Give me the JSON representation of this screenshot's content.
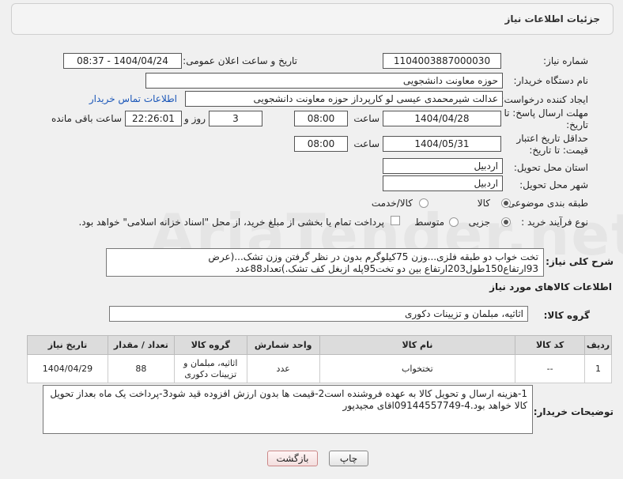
{
  "header": {
    "title": "جزئیات اطلاعات نیاز"
  },
  "fields": {
    "need_number_label": "شماره نیاز:",
    "need_number": "1104003887000030",
    "announce_label": "تاریخ و ساعت اعلان عمومی:",
    "announce_value": "1404/04/24 - 08:37",
    "buyer_org_label": "نام دستگاه خریدار:",
    "buyer_org": "حوزه معاونت دانشجویی",
    "creator_label": "ایجاد کننده درخواست:",
    "creator": "عدالت شیرمحمدی عیسی لو کارپرداز حوزه معاونت دانشجویی",
    "contact_link": "اطلاعات تماس خریدار",
    "deadline_label": "مهلت ارسال پاسخ: تا تاریخ:",
    "deadline_date": "1404/04/28",
    "time_label": "ساعت",
    "deadline_time": "08:00",
    "days_value": "3",
    "days_label": "روز و",
    "remaining_time": "22:26:01",
    "remaining_label": "ساعت باقی مانده",
    "validity_label": "حداقل تاریخ اعتبار قیمت: تا تاریخ:",
    "validity_date": "1404/05/31",
    "validity_time": "08:00",
    "province_label": "استان محل تحویل:",
    "province": "اردبیل",
    "city_label": "شهر محل تحویل:",
    "city": "اردبیل",
    "category_label": "طبقه بندی موضوعی:",
    "category_options": [
      "کالا",
      "کالا/خدمت"
    ],
    "process_label": "نوع فرآیند خرید :",
    "process_options": [
      "جزیی",
      "متوسط"
    ],
    "payment_note": "پرداخت تمام یا بخشی از مبلغ خرید، از محل \"اسناد خزانه اسلامی\" خواهد بود.",
    "summary_label": "شرح کلی نیاز:",
    "summary": "تخت خواب دو طبقه فلزی...وزن 75کیلوگرم بدون در نظر گرفتن وزن تشک...(عرض 93ارتفاع150طول203ارتفاع بین دو تخت95پله ازبغل کف تشک.)تعداد88عدد",
    "items_section": "اطلاعات کالاهای مورد نیاز",
    "group_label": "گروه کالا:",
    "group_value": "اثاثیه، مبلمان و تزیینات دکوری",
    "notes_label": "توضیحات خریدار:",
    "notes": "1-هزینه ارسال و تحویل کالا به عهده فروشنده است2-قیمت ها بدون ارزش افزوده قید شود3-پرداخت یک ماه بعداز تحویل کالا خواهد بود.4-09144557749اقای مجیدپور"
  },
  "table": {
    "headers": [
      "ردیف",
      "کد کالا",
      "نام کالا",
      "واحد شمارش",
      "گروه کالا",
      "تعداد / مقدار",
      "تاریخ نیاز"
    ],
    "rows": [
      [
        "1",
        "--",
        "تختخواب",
        "عدد",
        "اثاثیه، مبلمان و تزیینات دکوری",
        "88",
        "1404/04/29"
      ]
    ]
  },
  "buttons": {
    "print": "چاپ",
    "back": "بازگشت"
  },
  "watermark": "AriaTender.net"
}
